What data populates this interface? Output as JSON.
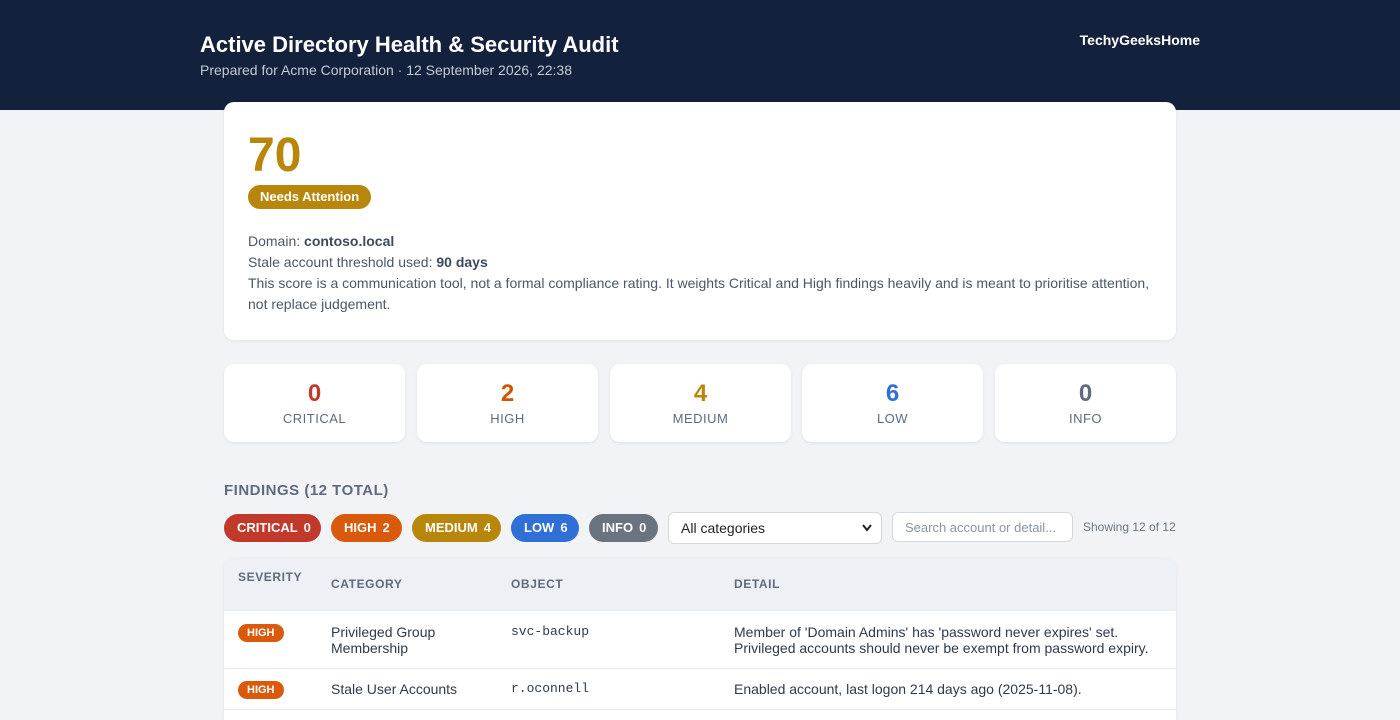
{
  "header": {
    "title": "Active Directory Health & Security Audit",
    "subtitle": "Prepared for Acme Corporation · 12 September 2026, 22:38",
    "brand": "TechyGeeksHome"
  },
  "score": {
    "value": "70",
    "status": "Needs Attention",
    "domain_label": "Domain:",
    "domain_value": "contoso.local",
    "threshold_label": "Stale account threshold used:",
    "threshold_value": "90 days",
    "note": "This score is a communication tool, not a formal compliance rating. It weights Critical and High findings heavily and is meant to prioritise attention, not replace judgement."
  },
  "stats": [
    {
      "count": "0",
      "label": "CRITICAL",
      "color": "#c0392b"
    },
    {
      "count": "2",
      "label": "HIGH",
      "color": "#d35400"
    },
    {
      "count": "4",
      "label": "MEDIUM",
      "color": "#b8860b"
    },
    {
      "count": "6",
      "label": "LOW",
      "color": "#2f6fd6"
    },
    {
      "count": "0",
      "label": "INFO",
      "color": "#5f6b7c"
    }
  ],
  "findings": {
    "title": "FINDINGS (12 TOTAL)",
    "chips": [
      {
        "label": "CRITICAL",
        "count": "0",
        "color": "#c0392b"
      },
      {
        "label": "HIGH",
        "count": "2",
        "color": "#d95a0b"
      },
      {
        "label": "MEDIUM",
        "count": "4",
        "color": "#b8860b"
      },
      {
        "label": "LOW",
        "count": "6",
        "color": "#2f6fd6"
      },
      {
        "label": "INFO",
        "count": "0",
        "color": "#6b7280"
      }
    ],
    "category_select": "All categories",
    "search_placeholder": "Search account or detail...",
    "showing": "Showing 12 of 12",
    "columns": [
      "SEVERITY",
      "CATEGORY",
      "OBJECT",
      "DETAIL"
    ],
    "rows": [
      {
        "severity": "HIGH",
        "category_line1": "Privileged Group",
        "category_line2": "Membership",
        "object": "svc-backup",
        "detail_line1": "Member of 'Domain Admins' has 'password never expires' set.",
        "detail_line2": "Privileged accounts should never be exempt from password expiry."
      },
      {
        "severity": "HIGH",
        "category_line1": "Stale User Accounts",
        "object": "r.oconnell",
        "detail_line1": "Enabled account, last logon 214 days ago (2025-11-08)."
      }
    ]
  }
}
